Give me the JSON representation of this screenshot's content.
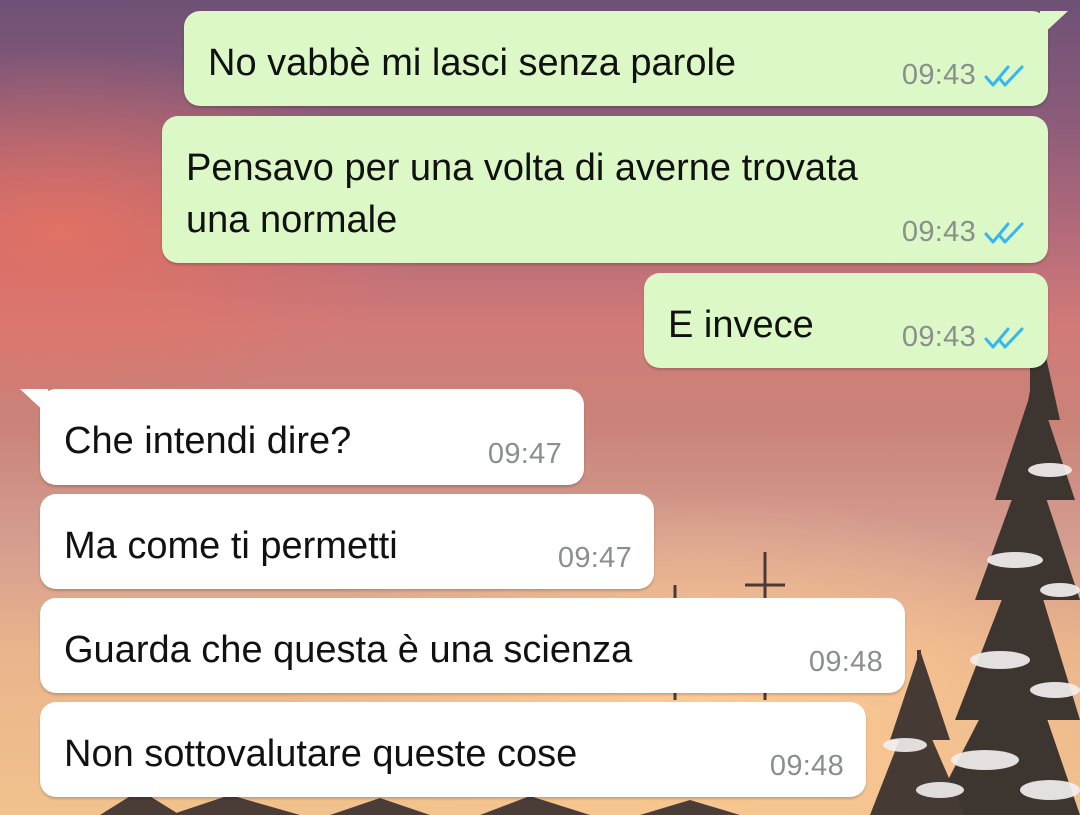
{
  "chat": {
    "colors": {
      "outgoing_bubble": "#dcf8c6",
      "incoming_bubble": "#ffffff",
      "read_ticks": "#34b7f1",
      "timestamp": "#8a8f8c"
    },
    "messages": [
      {
        "direction": "outgoing",
        "text": "No vabbè mi lasci senza parole",
        "time": "09:43",
        "status": "read",
        "status_icon": "double-check-icon"
      },
      {
        "direction": "outgoing",
        "text": "Pensavo per una volta di averne trovata\nuna normale",
        "time": "09:43",
        "status": "read",
        "status_icon": "double-check-icon"
      },
      {
        "direction": "outgoing",
        "text": "E invece",
        "time": "09:43",
        "status": "read",
        "status_icon": "double-check-icon"
      },
      {
        "direction": "incoming",
        "text": "Che intendi dire?",
        "time": "09:47"
      },
      {
        "direction": "incoming",
        "text": "Ma come ti permetti",
        "time": "09:47"
      },
      {
        "direction": "incoming",
        "text": "Guarda che questa è una scienza",
        "time": "09:48"
      },
      {
        "direction": "incoming",
        "text": "Non sottovalutare queste cose",
        "time": "09:48"
      }
    ]
  }
}
